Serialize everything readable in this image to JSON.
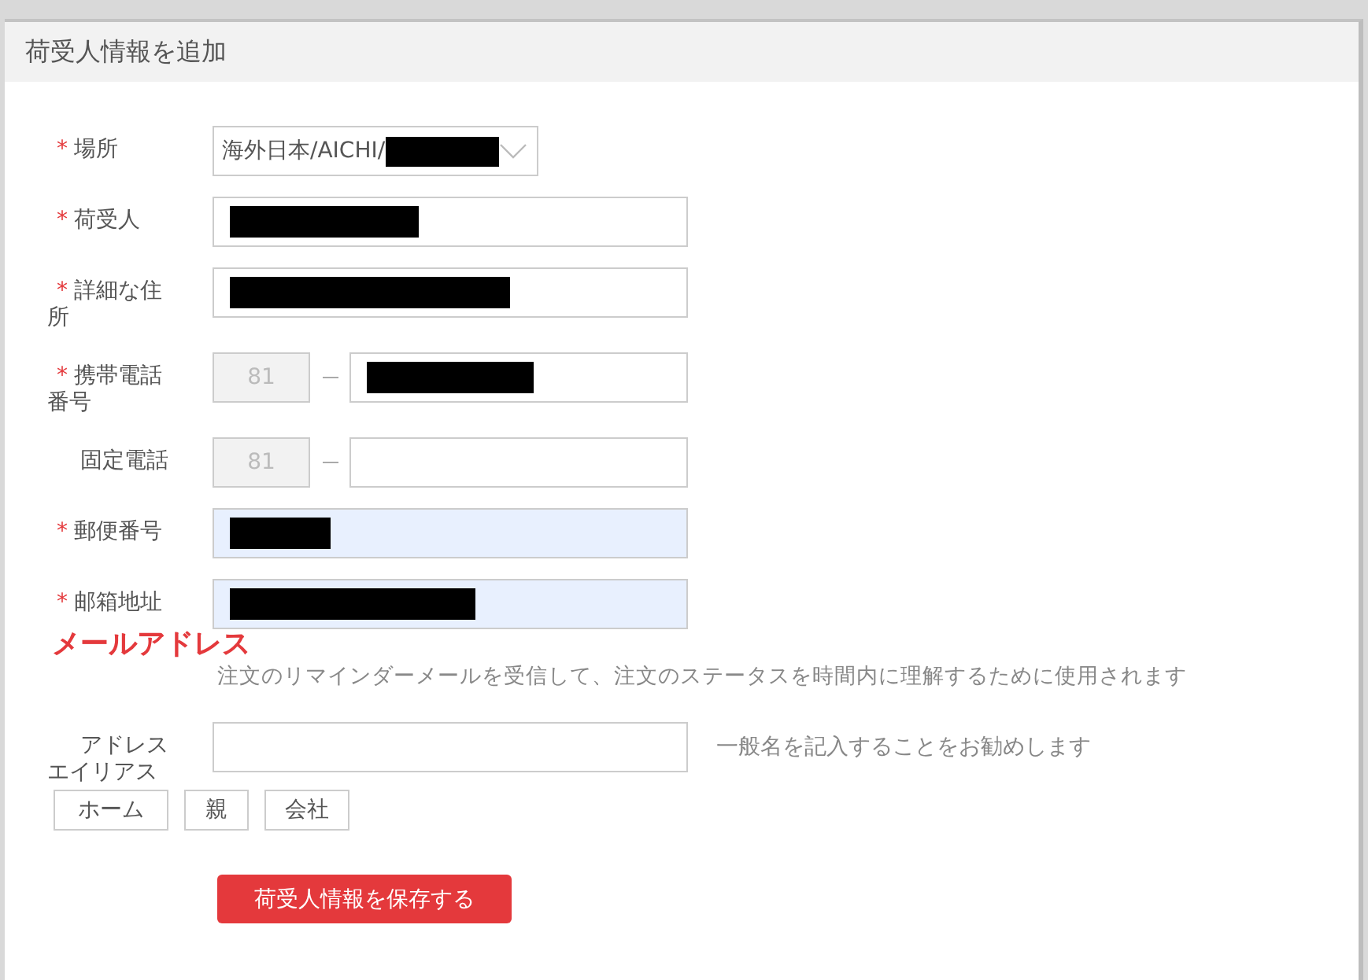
{
  "dialog": {
    "title": "荷受人情報を追加"
  },
  "fields": [
    {
      "kind": "select",
      "label": "場所",
      "required_mark": "*",
      "value": "海外日本/AICHI/",
      "redacted": true,
      "highlighted": false
    },
    {
      "kind": "text",
      "label": "荷受人",
      "required_mark": "*",
      "redacted": true,
      "highlighted": false
    },
    {
      "kind": "text",
      "label": "詳細な住所",
      "required_mark": "*",
      "redacted": true,
      "highlighted": false
    },
    {
      "kind": "phone",
      "label": "携帯電話番号",
      "required_mark": "*",
      "country_code": "81",
      "redacted": true,
      "highlighted": false
    },
    {
      "kind": "phone",
      "label": "固定電話",
      "country_code": "81",
      "redacted": false,
      "highlighted": false
    },
    {
      "kind": "text",
      "label": "郵便番号",
      "required_mark": "*",
      "redacted": true,
      "highlighted": true
    },
    {
      "kind": "text",
      "label": "邮箱地址",
      "required_mark": "*",
      "redacted": true,
      "highlighted": true
    }
  ],
  "annotation": "メールアドレス",
  "email_help": "注文のリマインダーメールを受信して、注文のステータスを時間内に理解するために使用されます",
  "alias": {
    "label": "アドレスエイリアス",
    "hint": "一般名を記入することをお勧めします",
    "tags": [
      "ホーム",
      "親",
      "会社"
    ]
  },
  "save_button": "荷受人情報を保存する"
}
